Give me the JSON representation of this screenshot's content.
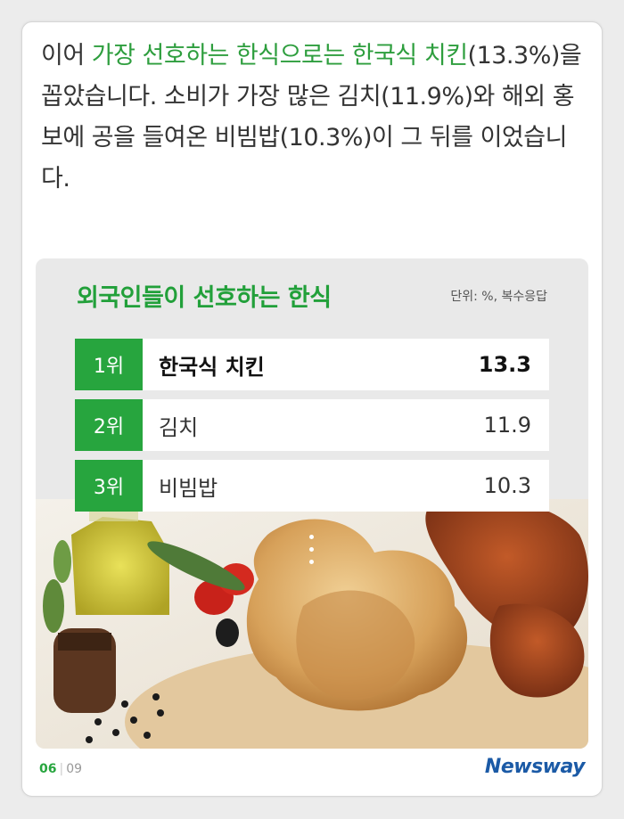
{
  "intro": {
    "pre": "이어 ",
    "highlight": "가장 선호하는 한식으로는 한국식 치킨",
    "rest": "(13.3%)을 꼽았습니다. 소비가 가장 많은 김치(11.9%)와 해외 홍보에 공을 들여온 비빔밥(10.3%)이 그 뒤를 이었습니다."
  },
  "panel": {
    "title": "외국인들이 선호하는 한식",
    "unit": "단위: %, 복수응답",
    "ranks": [
      {
        "rank": "1위",
        "name": "한국식 치킨",
        "value": "13.3"
      },
      {
        "rank": "2위",
        "name": "김치",
        "value": "11.9"
      },
      {
        "rank": "3위",
        "name": "비빔밥",
        "value": "10.3"
      }
    ],
    "image_alt": "fried-chicken-photo"
  },
  "footer": {
    "current_page": "06",
    "total_pages": "09",
    "brand": "Newsway"
  },
  "colors": {
    "accent_green": "#27a53e",
    "brand_blue": "#1b5aa6"
  }
}
